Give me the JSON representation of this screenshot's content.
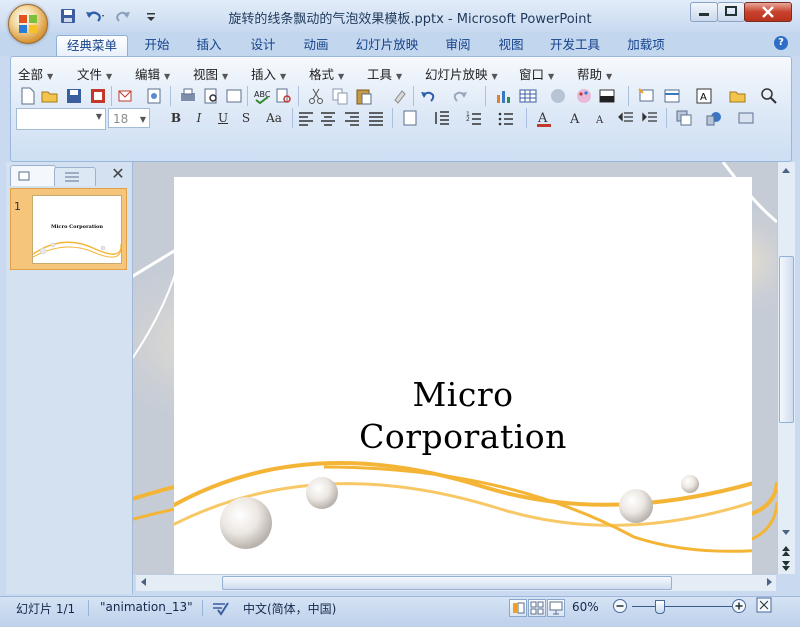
{
  "window": {
    "title": "旋转的线条飘动的气泡效果模板.pptx - Microsoft PowerPoint"
  },
  "tabs": [
    {
      "label": "经典菜单",
      "active": true
    },
    {
      "label": "开始"
    },
    {
      "label": "插入"
    },
    {
      "label": "设计"
    },
    {
      "label": "动画"
    },
    {
      "label": "幻灯片放映"
    },
    {
      "label": "审阅"
    },
    {
      "label": "视图"
    },
    {
      "label": "开发工具"
    },
    {
      "label": "加载项"
    }
  ],
  "classic_menu": [
    {
      "label": "全部"
    },
    {
      "label": "文件"
    },
    {
      "label": "编辑"
    },
    {
      "label": "视图"
    },
    {
      "label": "插入"
    },
    {
      "label": "格式"
    },
    {
      "label": "工具"
    },
    {
      "label": "幻灯片放映"
    },
    {
      "label": "窗口"
    },
    {
      "label": "帮助"
    }
  ],
  "format_bar": {
    "font_name": "",
    "font_size": "18",
    "bold": "B",
    "italic": "I",
    "underline": "U",
    "shadow": "S",
    "change_case": "Aa"
  },
  "slide_pane": {
    "thumbnail_number": "1",
    "thumbnail_title": "Micro Corporation"
  },
  "slide": {
    "title_line1": "Micro",
    "title_line2": "Corporation"
  },
  "status": {
    "slide_info": "幻灯片 1/1",
    "theme": "\"animation_13\"",
    "language": "中文(简体，中国)",
    "zoom": "60%"
  },
  "colors": {
    "ribbon_blue": "#c2d6ee",
    "wave_gold": "#f4b537",
    "thumbnail_highlight": "#f6c57c"
  }
}
